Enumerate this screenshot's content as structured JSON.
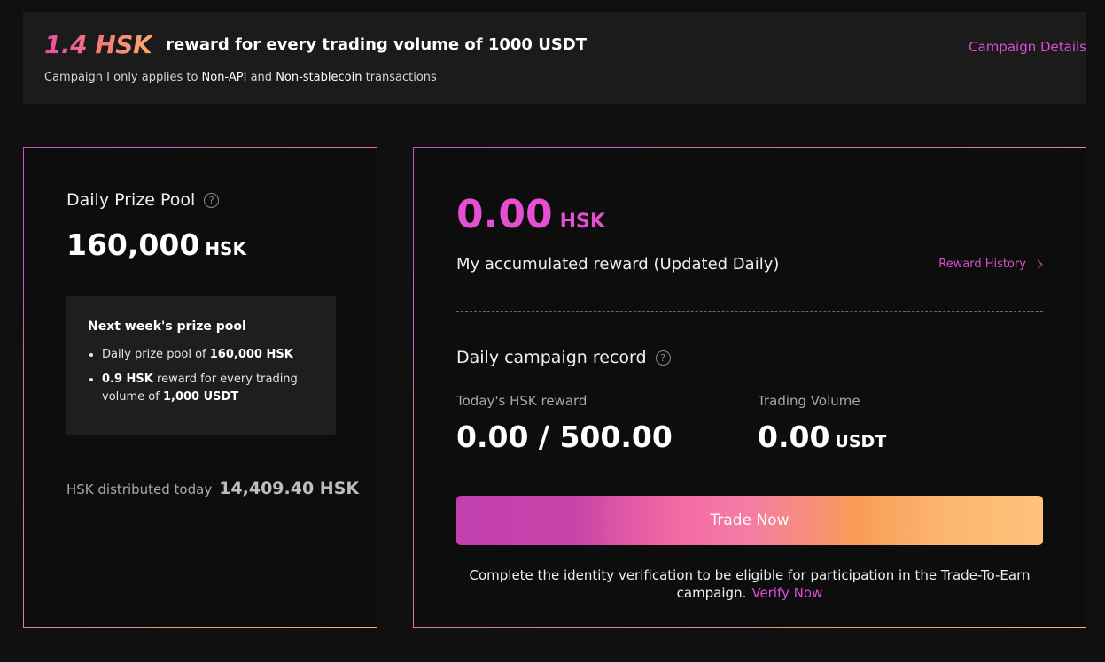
{
  "banner": {
    "amount": "1.4 HSK",
    "headline": "reward for every trading volume of 1000 USDT",
    "details_link": "Campaign Details",
    "note_prefix": "Campaign I only applies to",
    "note_term1": "Non-API",
    "note_and": "and",
    "note_term2": "Non-stablecoin",
    "note_suffix": "transactions"
  },
  "prize_pool": {
    "title": "Daily Prize Pool",
    "value": "160,000",
    "unit": "HSK",
    "next_week": {
      "title": "Next week's prize pool",
      "item1_prefix": "Daily prize pool of",
      "item1_value": "160,000 HSK",
      "item2_value": "0.9 HSK",
      "item2_text": "reward for every trading volume of",
      "item2_amount": "1,000 USDT"
    },
    "distributed_label": "HSK distributed today",
    "distributed_value": "14,409.40 HSK"
  },
  "my_reward": {
    "value": "0.00",
    "unit": "HSK",
    "label": "My accumulated reward (Updated Daily)",
    "history_link": "Reward History"
  },
  "daily_record": {
    "title": "Daily campaign record",
    "today_label": "Today's HSK reward",
    "today_value": "0.00 / 500.00",
    "volume_label": "Trading Volume",
    "volume_value": "0.00",
    "volume_unit": "USDT"
  },
  "actions": {
    "trade_button": "Trade Now",
    "verify_text": "Complete the identity verification to be eligible for participation in the Trade-To-Earn campaign.",
    "verify_link": "Verify Now"
  },
  "colors": {
    "background": "#101010",
    "accent_pink": "#e64fd2",
    "link": "#d94fd0",
    "gradient_start": "#c13fae",
    "gradient_end": "#fdc27c"
  },
  "icons": {
    "help": "question-circle-icon",
    "chevron": "chevron-right-icon"
  }
}
